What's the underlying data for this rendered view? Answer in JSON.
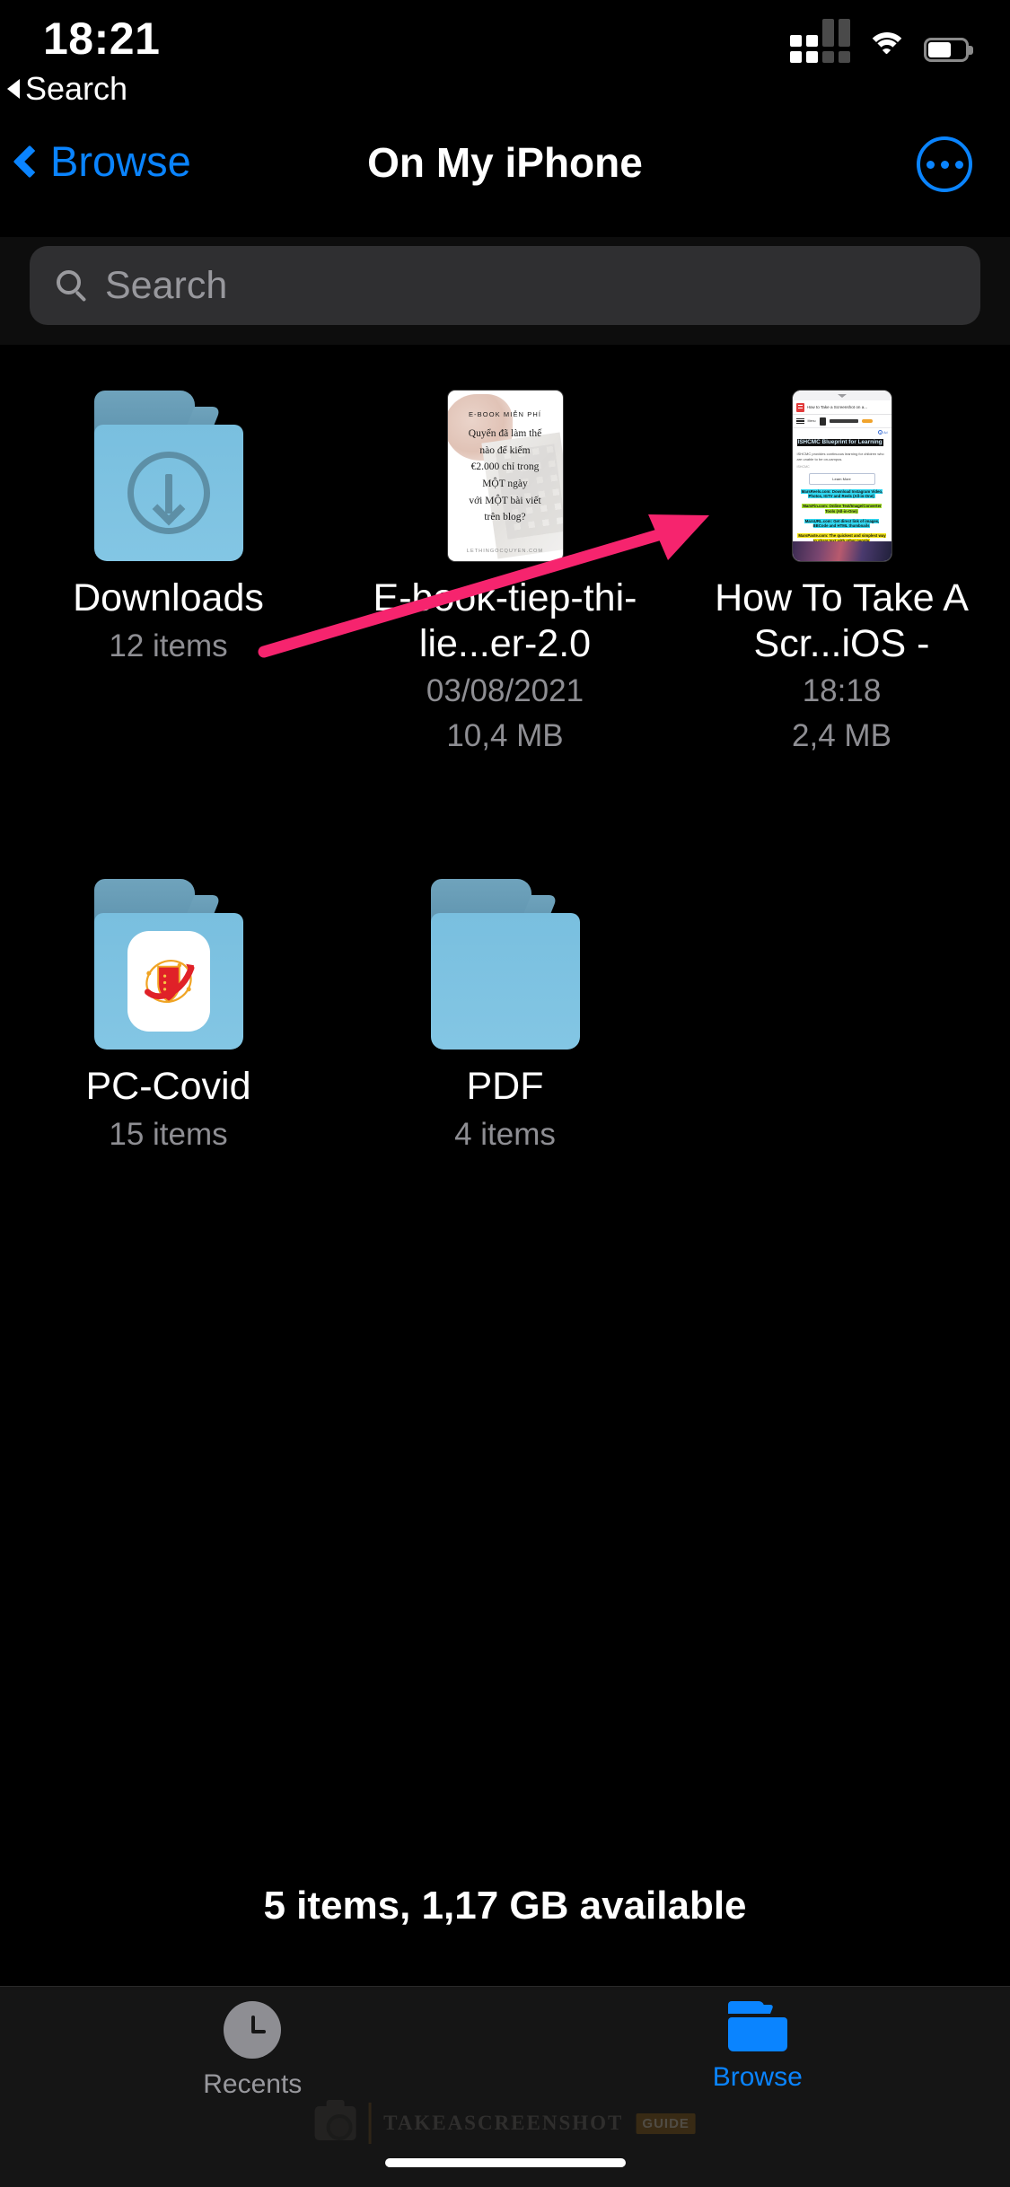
{
  "status_bar": {
    "time": "18:21",
    "back_app_label": "Search",
    "back_arrow_icon": "triangle-left-icon",
    "cellular_icon": "cellular-signal-icon",
    "wifi_icon": "wifi-icon",
    "battery_icon": "battery-icon"
  },
  "nav": {
    "back_label": "Browse",
    "back_icon": "chevron-left-icon",
    "title": "On My iPhone",
    "more_icon": "ellipsis-circle-icon"
  },
  "search": {
    "placeholder": "Search",
    "value": "",
    "icon": "magnifier-icon"
  },
  "grid": {
    "rows": [
      [
        {
          "kind": "folder",
          "name": "Downloads",
          "subtitle": "12 items",
          "subtitle2": "",
          "icon": "folder-downloads-icon"
        },
        {
          "kind": "pdf",
          "name": "E-book-tiep-thi-lie...er-2.0",
          "subtitle": "03/08/2021",
          "subtitle2": "10,4 MB",
          "icon": "pdf-thumbnail",
          "cover": {
            "kicker": "E-BOOK MIỄN PHÍ",
            "lines": [
              "Quyển đã làm thế",
              "nào để kiếm",
              "€2.000 chỉ trong",
              "MỘT ngày",
              "với MỘT bài viết",
              "trên blog?"
            ],
            "footer": "LETHINGOCQUYEN.COM"
          }
        },
        {
          "kind": "screenshot",
          "name": "How To Take A Scr...iOS -",
          "subtitle": "18:18",
          "subtitle2": "2,4 MB",
          "icon": "screenshot-thumbnail",
          "preview": {
            "tab_title": "How to Take a Screenshot on a...",
            "menu_label": "Menu",
            "ad_label": "Ad",
            "headline": "ISHCMC Blueprint for Learning",
            "paragraph": "ISHCMC provides continuous learning for children who are unable to be on-campus.",
            "source": "ISHCMC",
            "button_label": "Learn More",
            "highlights": [
              {
                "color": "cyan",
                "text": "MarsReels.com: Download Instagram Video, Photos, IGTV and Reels (All-in-One)"
              },
              {
                "color": "green",
                "text": "MarsFin.com: Online Text/Image/Converter Tools (All-in-One)"
              },
              {
                "color": "cyan",
                "text": "MarsURL.com: Get direct link of images, BBCode and HTML thumbnails"
              },
              {
                "color": "yellow",
                "text": "MarsPaste.com: The quickest and simplest way to share text with other people"
              }
            ]
          }
        }
      ],
      [
        {
          "kind": "folder",
          "name": "PC-Covid",
          "subtitle": "15 items",
          "subtitle2": "",
          "icon": "folder-app-icon"
        },
        {
          "kind": "folder",
          "name": "PDF",
          "subtitle": "4 items",
          "subtitle2": "",
          "icon": "folder-plain-icon"
        }
      ]
    ]
  },
  "footer": {
    "status": "5 items, 1,17 GB available"
  },
  "tabbar": {
    "items": [
      {
        "label": "Recents",
        "icon": "clock-icon",
        "active": false
      },
      {
        "label": "Browse",
        "icon": "folder-icon",
        "active": true
      }
    ]
  },
  "watermark": {
    "text": "TAKEASCREENSHOT",
    "badge": "GUIDE",
    "icon": "camera-icon"
  },
  "colors": {
    "accent": "#0a84ff",
    "background": "#000000",
    "search_field": "#2f2f31",
    "secondary_text": "#8e8e93",
    "arrow": "#f6246e",
    "folder_body": "#79bfdf",
    "folder_tab": "#6fa3bc"
  }
}
